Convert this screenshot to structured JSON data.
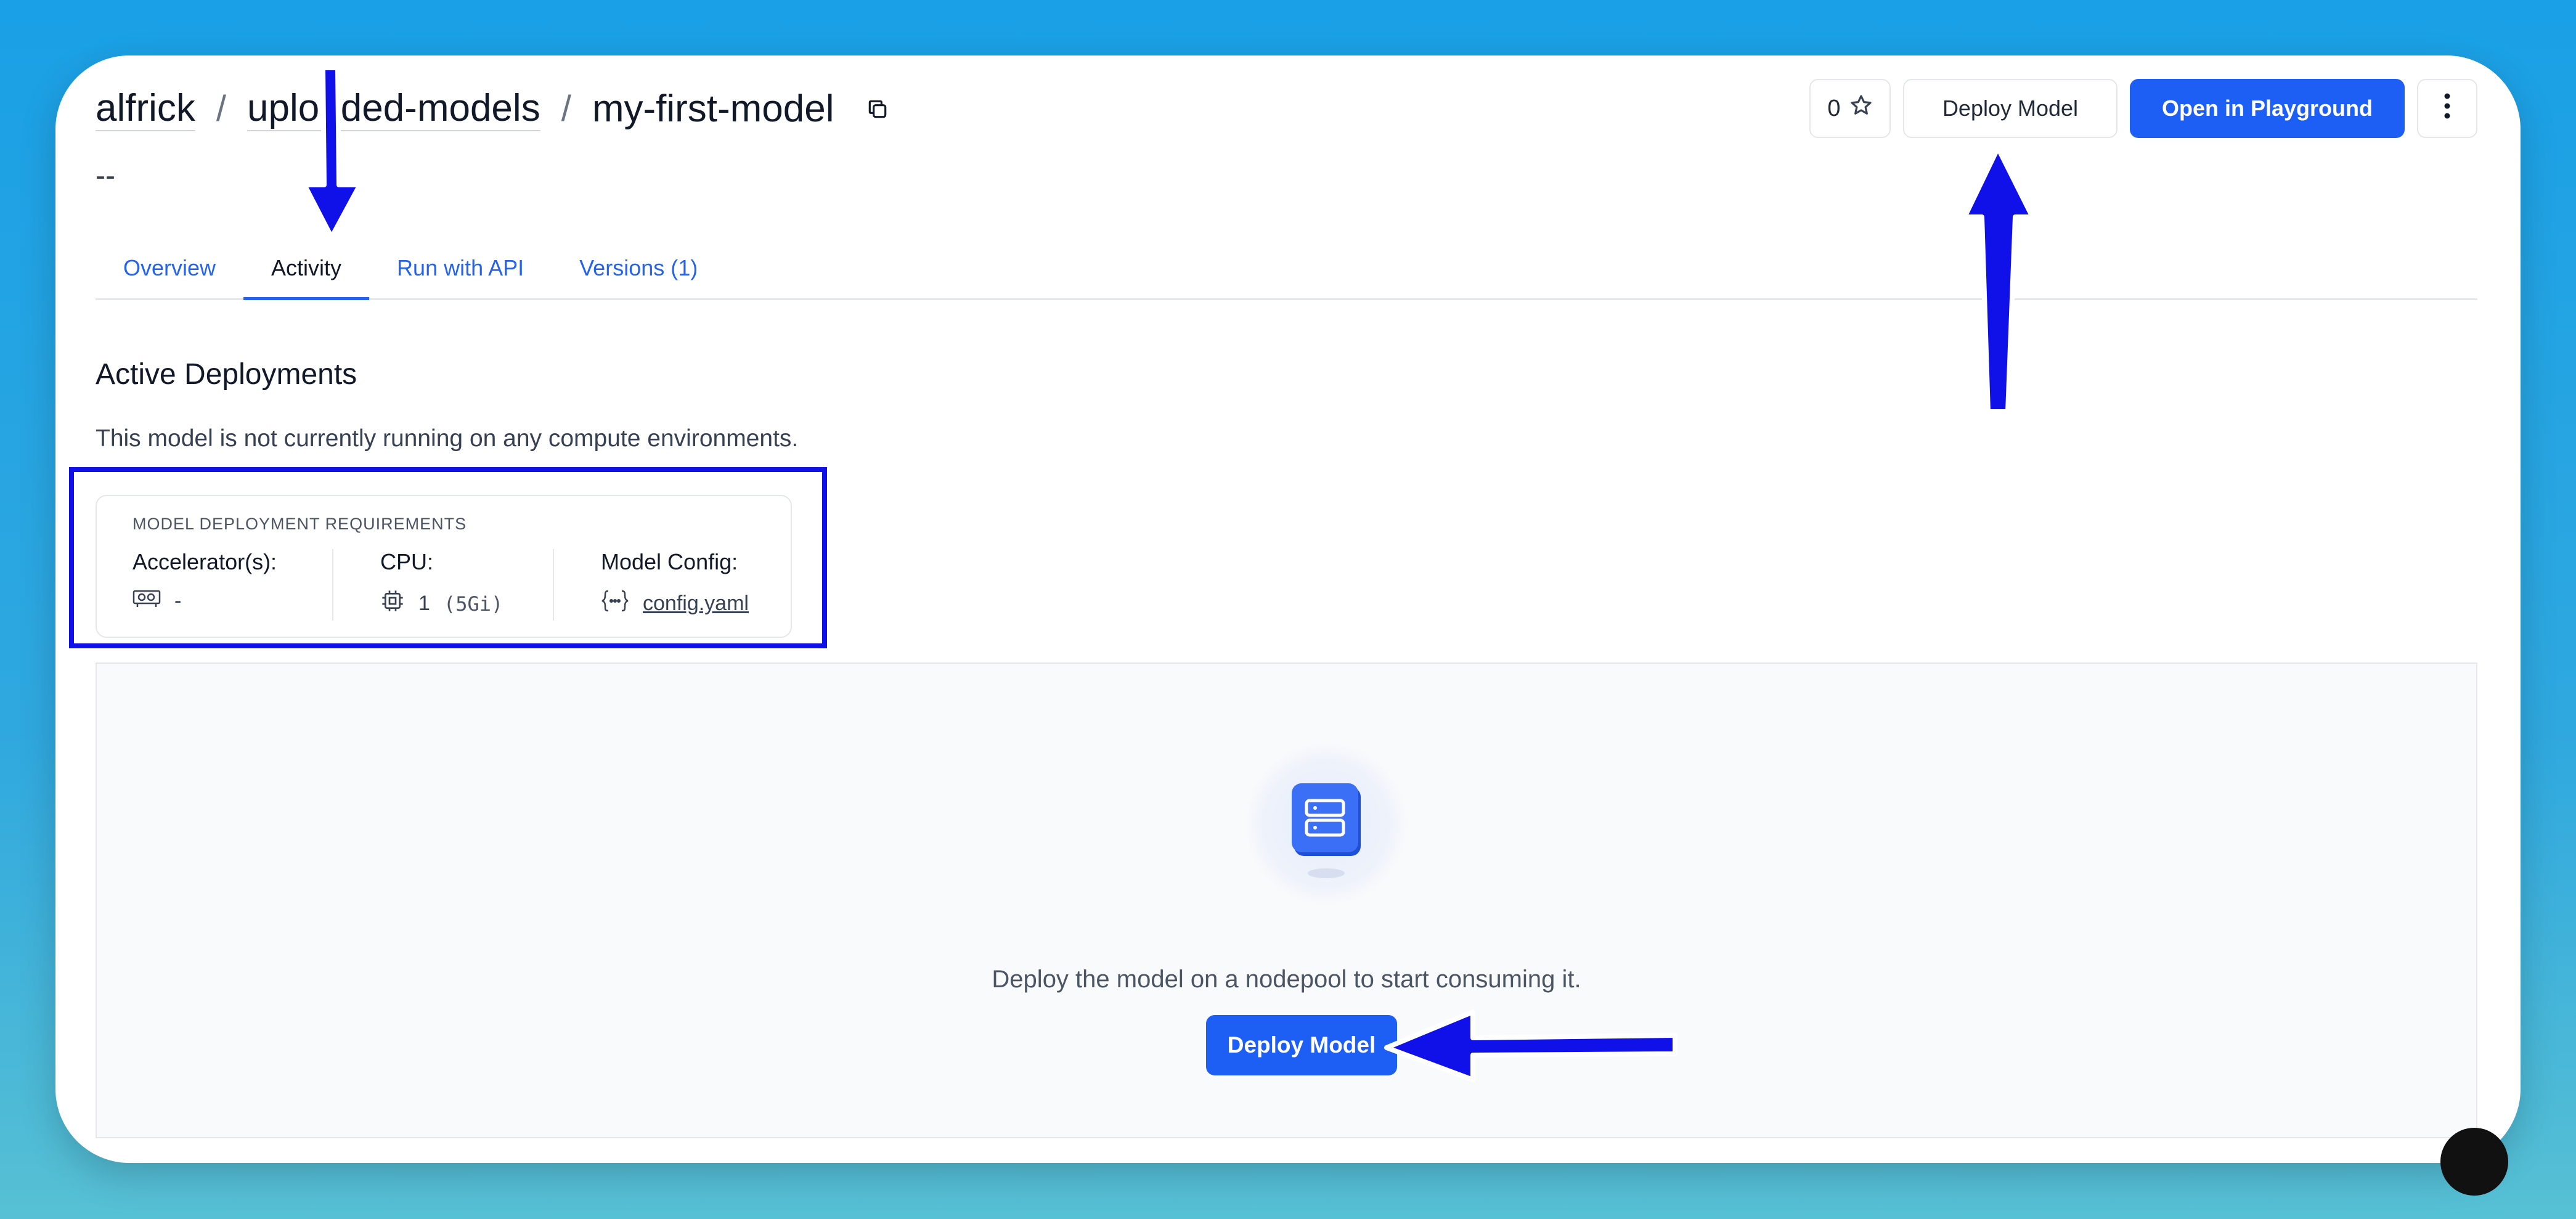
{
  "breadcrumb": {
    "owner": "alfrick",
    "app": "uploaded-models",
    "model": "my-first-model",
    "separator": "/"
  },
  "description": "--",
  "header_actions": {
    "star_count": "0",
    "deploy_label": "Deploy Model",
    "playground_label": "Open in Playground"
  },
  "tabs": [
    {
      "label": "Overview"
    },
    {
      "label": "Activity"
    },
    {
      "label": "Run with API"
    },
    {
      "label": "Versions (1)"
    }
  ],
  "active_tab": "Activity",
  "deployments": {
    "title": "Active Deployments",
    "subtitle": "This model is not currently running on any compute environments."
  },
  "requirements": {
    "heading": "MODEL DEPLOYMENT REQUIREMENTS",
    "accelerator_label": "Accelerator(s):",
    "accelerator_value": "-",
    "cpu_label": "CPU:",
    "cpu_value": "1",
    "cpu_memory": "(5Gi)",
    "config_label": "Model Config:",
    "config_file": "config.yaml"
  },
  "empty_state": {
    "text": "Deploy the model on a nodepool to start consuming it.",
    "button_label": "Deploy Model"
  },
  "colors": {
    "primary": "#1d5ef5",
    "link": "#2563eb",
    "annotation": "#1010e8"
  }
}
